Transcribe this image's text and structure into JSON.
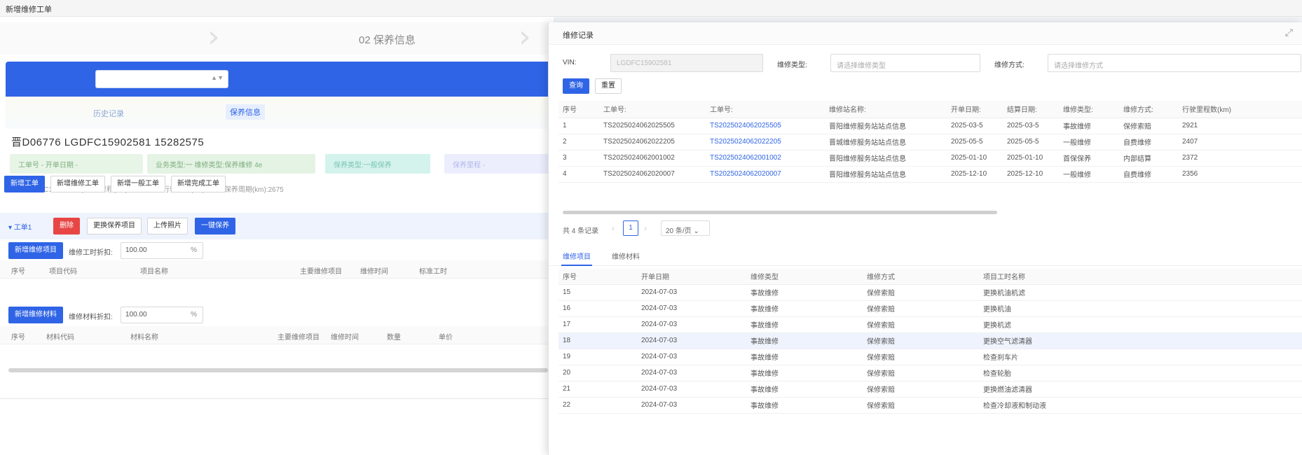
{
  "window": {
    "tab_title": "新增维修工单"
  },
  "steps": {
    "current_label": "02 保养信息"
  },
  "left": {
    "sub_tabs": [
      "历史记录",
      "保养信息"
    ],
    "vehicle_line": "晋D06776  LGDFC15902581  15282575",
    "tags": [
      "工单号 -    开单日期 -",
      "业务类型:一    维修类型:保养维修 4e",
      "保养类型:一般保养",
      "保养里程 -"
    ],
    "info_line": "VIN:LGDFC15902581 | 车辆里程(km):15282575    行驶里程(km):2675    保养周期(km):2675",
    "action_buttons": [
      "新增工单",
      "新增维修工单",
      "新增一般工单",
      "新增完成工单"
    ],
    "toggle_label": "工单1",
    "work_buttons": [
      "删除",
      "更换保养项目",
      "上传照片",
      "一键保养"
    ],
    "section1": {
      "add_button": "新增维修项目",
      "pct_label": "维修工时折扣:",
      "pct_value": "100.00",
      "unit": "%",
      "columns": [
        "序号",
        "项目代码",
        "项目名称",
        "主要维修项目",
        "维修时间",
        "标准工时"
      ]
    },
    "section2": {
      "add_button": "新增维修材料",
      "pct_label": "维修材料折扣:",
      "pct_value": "100.00",
      "unit": "%",
      "columns": [
        "序号",
        "材料代码",
        "材料名称",
        "主要维修项目",
        "维修时间",
        "数量",
        "单价"
      ]
    }
  },
  "dialog": {
    "title": "维修记录",
    "close_icon": "expand-icon",
    "filters": {
      "vin_label": "VIN:",
      "vin_value": "LGDFC15902581",
      "type_label": "维修类型:",
      "type_placeholder": "请选择维修类型",
      "category_label": "维修方式:",
      "category_placeholder": "请选择维修方式"
    },
    "buttons": {
      "search": "查询",
      "reset": "重置"
    },
    "records": {
      "columns": [
        "序号",
        "工单号:",
        "工单号:",
        "维修站名称:",
        "开单日期:",
        "结算日期:",
        "维修类型:",
        "维修方式:",
        "行驶里程数(km)"
      ],
      "rows": [
        [
          "1",
          "TS2025024062025505",
          "TS2025024062025505",
          "晋阳维修服务站站点信息",
          "2025-03-5",
          "2025-03-5",
          "事故维修",
          "保修索赔",
          "2921"
        ],
        [
          "2",
          "TS2025024062022205",
          "TS2025024062022205",
          "晋城维修服务站站点信息",
          "2025-05-5",
          "2025-05-5",
          "一般维修",
          "自费维修",
          "2407"
        ],
        [
          "3",
          "TS2025024062001002",
          "TS2025024062001002",
          "晋阳维修服务站站点信息",
          "2025-01-10",
          "2025-01-10",
          "首保保养",
          "内部结算",
          "2372"
        ],
        [
          "4",
          "TS2025024062020007",
          "TS2025024062020007",
          "晋阳维修服务站站点信息",
          "2025-12-10",
          "2025-12-10",
          "一般维修",
          "自费维修",
          "2356"
        ]
      ]
    },
    "pagination": {
      "total": "共 4 条记录",
      "page": "1",
      "page_size": "20 条/页"
    },
    "tabs": [
      "维修项目",
      "维修材料"
    ],
    "items": {
      "columns": [
        "序号",
        "开单日期",
        "维修类型",
        "维修方式",
        "项目工时名称"
      ],
      "rows": [
        [
          "15",
          "2024-07-03",
          "事故维修",
          "保修索赔",
          "更换机油机滤"
        ],
        [
          "16",
          "2024-07-03",
          "事故维修",
          "保修索赔",
          "更换机油"
        ],
        [
          "17",
          "2024-07-03",
          "事故维修",
          "保修索赔",
          "更换机滤"
        ],
        [
          "18",
          "2024-07-03",
          "事故维修",
          "保修索赔",
          "更换空气滤清器"
        ],
        [
          "19",
          "2024-07-03",
          "事故维修",
          "保修索赔",
          "检查刹车片"
        ],
        [
          "20",
          "2024-07-03",
          "事故维修",
          "保修索赔",
          "检查轮胎"
        ],
        [
          "21",
          "2024-07-03",
          "事故维修",
          "保修索赔",
          "更换燃油滤清器"
        ],
        [
          "22",
          "2024-07-03",
          "事故维修",
          "保修索赔",
          "检查冷却液和制动液"
        ]
      ]
    }
  }
}
